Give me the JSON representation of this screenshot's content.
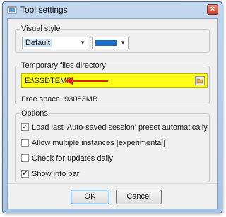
{
  "window": {
    "title": "Tool settings",
    "close_glyph": "×"
  },
  "visual_style": {
    "legend": "Visual style",
    "style_value": "Default",
    "color": "#1a6fce"
  },
  "temp_dir": {
    "legend": "Temporary files directory",
    "path": "E:\\SSDTEMP",
    "highlight_color": "#ffff1a",
    "arrow_color": "#e01b1b",
    "free_space": "Free space: 93083MB"
  },
  "options": {
    "legend": "Options",
    "items": [
      {
        "label": "Load last 'Auto-saved session' preset automatically",
        "checked": true
      },
      {
        "label": "Allow multiple instances [experimental]",
        "checked": false
      },
      {
        "label": "Check for updates daily",
        "checked": false
      },
      {
        "label": "Show info bar",
        "checked": true
      }
    ]
  },
  "buttons": {
    "ok": "OK",
    "cancel": "Cancel"
  }
}
